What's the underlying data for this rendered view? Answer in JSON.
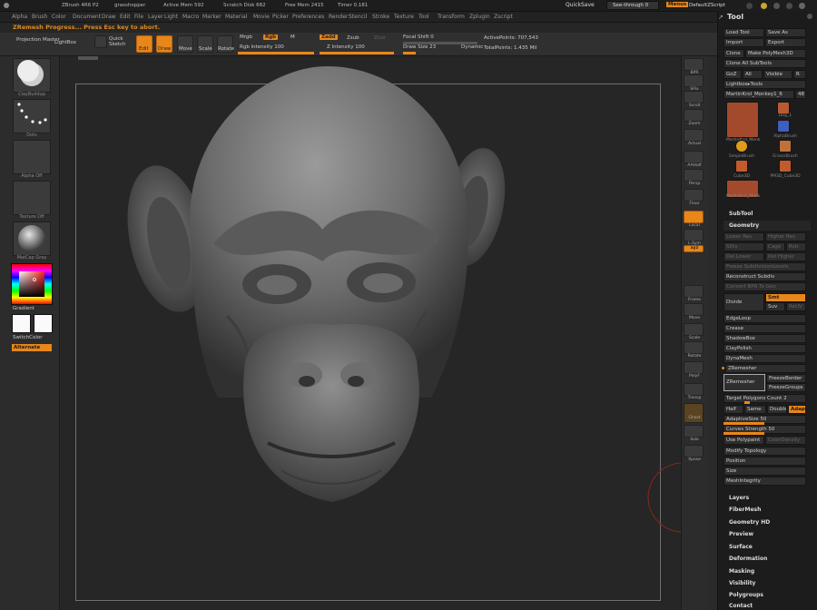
{
  "titlebar": {
    "app_info": "ZBrush 4R6 P2",
    "document": "grasshopper",
    "active_mem": "Active Mem 592",
    "scratch_disk": "Scratch Disk 682",
    "free_mem": "Free Mem 2415",
    "timer": "Timer 0.181",
    "quicksave": "QuickSave",
    "see_through": "See-through  0",
    "menus": "Menus",
    "default_zscript": "DefaultZScript"
  },
  "menubar": {
    "items": [
      "Alpha",
      "Brush",
      "Color",
      "Document",
      "Draw",
      "Edit",
      "File",
      "Layer",
      "Light",
      "Macro",
      "Marker",
      "Material",
      "Movie",
      "Picker",
      "Preferences",
      "Render",
      "Stencil",
      "Stroke",
      "Texture",
      "Tool",
      "Transform",
      "Zplugin",
      "Zscript"
    ]
  },
  "status": {
    "message": "ZRemesh Progress... Press Esc key to abort."
  },
  "topshelf": {
    "projection_master": "Projection Master",
    "lightbox": "LightBox",
    "quick_sketch": "Quick Sketch",
    "edit": "Edit",
    "draw": "Draw",
    "move": "Move",
    "scale": "Scale",
    "rotate": "Rotate",
    "mrgb": "Mrgb",
    "rgb": "Rgb",
    "m": "M",
    "rgb_intensity": "Rgb Intensity 100",
    "zadd": "Zadd",
    "zsub": "Zsub",
    "zcut": "Zcut",
    "z_intensity": "Z Intensity 100",
    "focal_shift": "Focal Shift 0",
    "draw_size": "Draw Size 23",
    "dynamic": "Dynamic",
    "active_points": "ActivePoints: 707,543",
    "total_points": "TotalPoints: 1.435 Mil"
  },
  "leftshelf": {
    "brush_label": "ClayBuildup",
    "stroke_label": "Dots",
    "alpha_label": "Alpha Off",
    "texture_label": "Texture Off",
    "material_label": "MatCap Gray",
    "gradient": "Gradient",
    "switch_color": "SwitchColor",
    "alternate": "Alternate"
  },
  "rightshelf": {
    "items": [
      "BPR",
      "SPix",
      "Scroll",
      "Zoom",
      "Actual",
      "AAHalf",
      "Persp",
      "Floor",
      "Local",
      "L.Sym",
      "xyz",
      "Frame",
      "Move",
      "Scale",
      "Rotate",
      "PolyF",
      "Transp",
      "Ghost",
      "Solo",
      "Xpose"
    ]
  },
  "tool": {
    "title": "Tool",
    "load_tool": "Load Tool",
    "save_as": "Save As",
    "import": "Import",
    "export": "Export",
    "clone": "Clone",
    "make_polymesh": "Make PolyMesh3D",
    "clone_all": "Clone All SubTools",
    "goz": "GoZ",
    "all": "All",
    "visible": "Visible",
    "r": "R",
    "lightbox_tools": "Lightbox▸Tools",
    "current_tool": "MartinKrol_Monkey1_6",
    "current_tool_count": "48",
    "thumbs": [
      {
        "caption": "MartinKrol_Monk",
        "color": "#a34a2c"
      },
      {
        "caption": "Dog_1",
        "color": "#b85a33"
      },
      {
        "caption": "AlphaBrush",
        "color": "#3f5fbf"
      },
      {
        "caption": "SimpleBrush",
        "color": "#e09a1c"
      },
      {
        "caption": "EraserBrush",
        "color": "#c0703a"
      },
      {
        "caption": "Cube3D",
        "color": "#c25a2e"
      },
      {
        "caption": "PM3D_Cube3D",
        "color": "#c25a2e"
      },
      {
        "caption": "MartinKrol_Monk",
        "color": "#a34a2c"
      }
    ],
    "subtool": "SubTool",
    "geometry": "Geometry",
    "lower_res": "Lower Res",
    "higher_res": "Higher Res",
    "sdiv": "SDiv",
    "cage": "Cage",
    "rstr": "Rstr",
    "del_lower": "Del Lower",
    "del_higher": "Del Higher",
    "freeze_subdiv": "Freeze SubdivisionLevels",
    "reconstruct": "Reconstruct Subdiv",
    "convert_bpr": "Convert BPR To Geo",
    "divide": "Divide",
    "smt": "Smt",
    "suv": "Suv",
    "reuv": "ReUV",
    "edgeloop": "EdgeLoop",
    "crease": "Crease",
    "shadowbox": "ShadowBox",
    "claypolish": "ClayPolish",
    "dynamesh": "DynaMesh",
    "zremesher_section": "ZRemesher",
    "zremesher_btn": "ZRemesher",
    "freeze_border": "FreezeBorder",
    "freeze_groups": "FreezeGroups",
    "target_polys": "Target Polygons Count 2",
    "half": "Half",
    "same": "Same",
    "double": "Double",
    "adapt": "Adapt",
    "adaptive_size": "AdaptiveSize 50",
    "curves_strength": "Curves Strength 50",
    "use_polypaint": "Use Polypaint",
    "color_density": "ColorDensity",
    "modify_topology": "Modify Topology",
    "position": "Position",
    "size": "Size",
    "mesh_integrity": "MeshIntegrity",
    "layers": "Layers",
    "fibermesh": "FiberMesh",
    "geometry_hd": "Geometry HD",
    "preview": "Preview",
    "surface": "Surface",
    "deformation": "Deformation",
    "masking": "Masking",
    "visibility": "Visibility",
    "polygroups": "Polygroups",
    "contact": "Contact"
  },
  "colors": {
    "accent": "#e8861a",
    "panel": "#1c1c1c",
    "canvas": "#262626"
  }
}
